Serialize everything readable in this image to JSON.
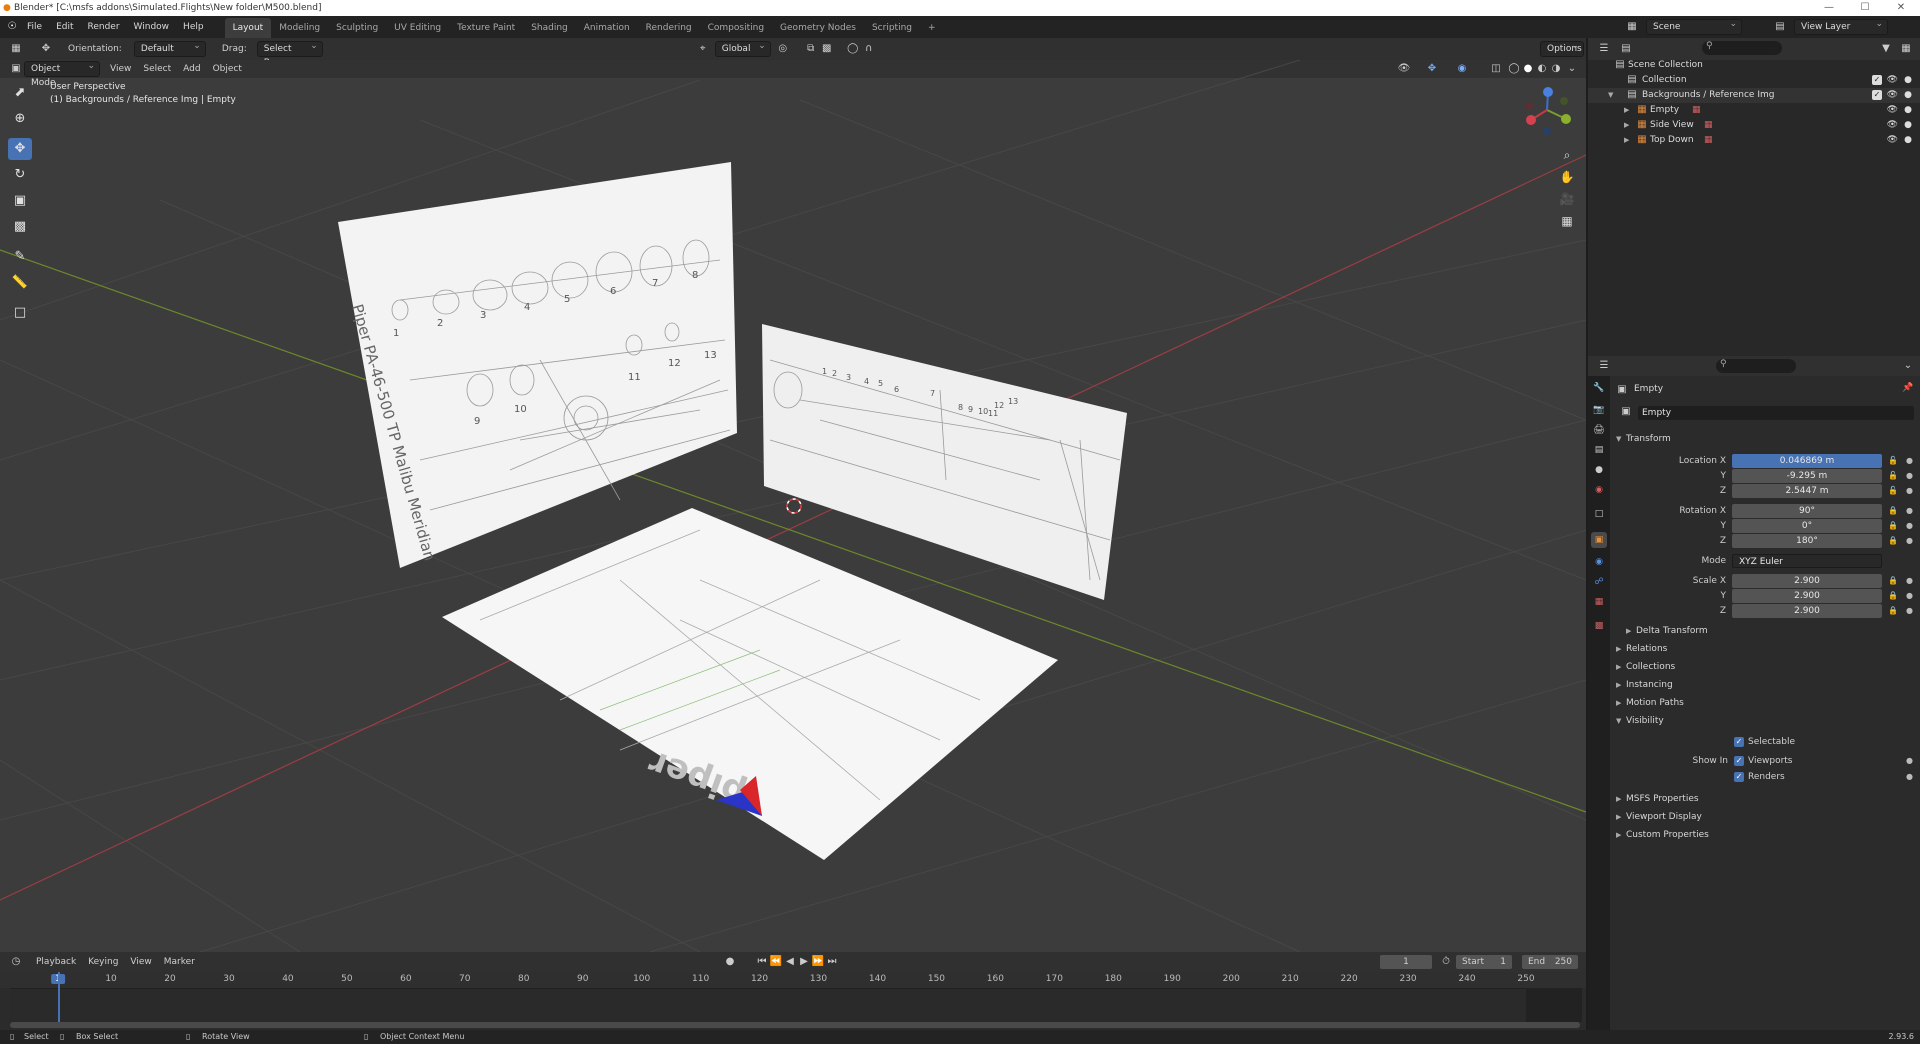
{
  "window": {
    "title": "Blender* [C:\\msfs addons\\Simulated.Flights\\New folder\\M500.blend]",
    "controls": [
      "—",
      "☐",
      "✕"
    ]
  },
  "menu": {
    "items": [
      "File",
      "Edit",
      "Render",
      "Window",
      "Help"
    ]
  },
  "workspaces": [
    "Layout",
    "Modeling",
    "Sculpting",
    "UV Editing",
    "Texture Paint",
    "Shading",
    "Animation",
    "Rendering",
    "Compositing",
    "Geometry Nodes",
    "Scripting"
  ],
  "scene": {
    "label": "Scene",
    "view_layer": "View Layer"
  },
  "tool_header": {
    "orientation_label": "Orientation:",
    "orientation_value": "Default",
    "drag_label": "Drag:",
    "drag_value": "Select Box",
    "transform_space": "Global",
    "options": "Options"
  },
  "viewport_header": {
    "mode": "Object Mode",
    "menus": [
      "View",
      "Select",
      "Add",
      "Object"
    ]
  },
  "viewport": {
    "perspective": "User Perspective",
    "context": "(1) Backgrounds / Reference Img | Empty"
  },
  "sheets": {
    "top_title": "Piper PA-46-500 TP  Malibu Meridian",
    "top_numbers": [
      "1",
      "2",
      "3",
      "4",
      "5",
      "6",
      "7",
      "8",
      "9",
      "10",
      "11",
      "12",
      "13"
    ],
    "side_numbers": [
      "1",
      "2",
      "3",
      "4",
      "5",
      "6",
      "7",
      "8",
      "9",
      "10",
      "11",
      "12",
      "13"
    ],
    "floor_logo": "piper"
  },
  "outliner": {
    "rows": [
      {
        "label": "Scene Collection",
        "icon": "scene-collection-icon"
      },
      {
        "label": "Collection",
        "icon": "collection-icon"
      },
      {
        "label": "Backgrounds / Reference Img",
        "icon": "collection-icon"
      },
      {
        "label": "Empty",
        "icon": "empty-icon"
      },
      {
        "label": "Side View",
        "icon": "image-empty-icon"
      },
      {
        "label": "Top Down",
        "icon": "image-empty-icon"
      }
    ]
  },
  "properties": {
    "object_name": "Empty",
    "data_name": "Empty",
    "transform_header": "Transform",
    "location": {
      "label": "Location X",
      "y": "Y",
      "z": "Z",
      "x_val": "0.046869 m",
      "y_val": "-9.295 m",
      "z_val": "2.5447 m"
    },
    "rotation": {
      "label": "Rotation X",
      "y": "Y",
      "z": "Z",
      "x_val": "90°",
      "y_val": "0°",
      "z_val": "180°"
    },
    "mode": {
      "label": "Mode",
      "value": "XYZ Euler"
    },
    "scale": {
      "label": "Scale X",
      "y": "Y",
      "z": "Z",
      "x_val": "2.900",
      "y_val": "2.900",
      "z_val": "2.900"
    },
    "delta": "Delta Transform",
    "sections1": [
      "Relations",
      "Collections",
      "Instancing",
      "Motion Paths",
      "Visibility"
    ],
    "selectable": "Selectable",
    "show_in": "Show In",
    "viewports": "Viewports",
    "renders": "Renders",
    "sections2": [
      "MSFS Properties",
      "Viewport Display",
      "Custom Properties"
    ]
  },
  "timeline": {
    "menus": [
      "Playback",
      "Keying",
      "View",
      "Marker"
    ],
    "current_frame": "1",
    "start_label": "Start",
    "start": "1",
    "end_label": "End",
    "end": "250",
    "ruler": [
      "1",
      "10",
      "20",
      "30",
      "40",
      "50",
      "60",
      "70",
      "80",
      "90",
      "100",
      "110",
      "120",
      "130",
      "140",
      "150",
      "160",
      "170",
      "180",
      "190",
      "200",
      "210",
      "220",
      "230",
      "240",
      "250"
    ]
  },
  "statusbar": {
    "select": "Select",
    "box_select": "Box Select",
    "rotate": "Rotate View",
    "context": "Object Context Menu",
    "version": "2.93.6"
  }
}
